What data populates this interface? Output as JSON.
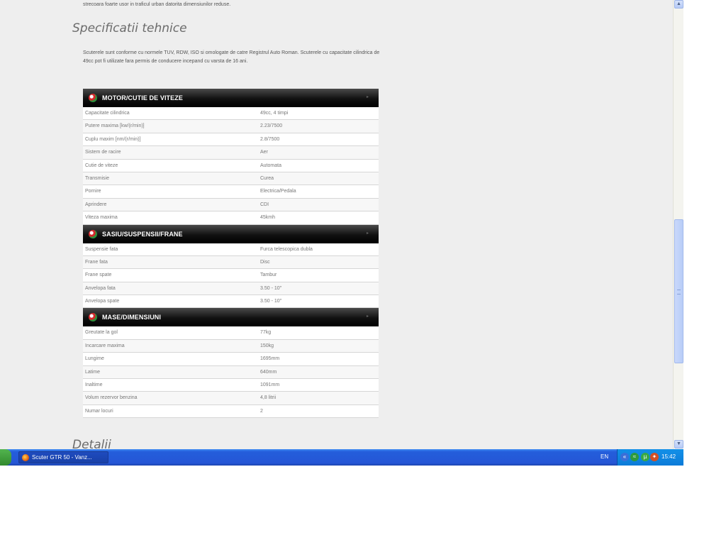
{
  "page": {
    "intro_tail": "strecoara foarte usor in traficul urban datorita dimensiunilor reduse.",
    "section_title": "Specificatii tehnice",
    "section_text": "Scuterele sunt conforme cu normele TUV, RDW, ISO si omologate de catre Registrul Auto Roman. Scuterele cu capacitate cilindrica de 49cc pot fi utilizate fara permis de conducere incepand cu varsta de 16 ani.",
    "next_title": "Detalii"
  },
  "spec_groups": [
    {
      "title": "MOTOR/CUTIE DE VITEZE",
      "rows": [
        {
          "k": "Capacitate cilindrica",
          "v": "49cc, 4 timpi"
        },
        {
          "k": "Putere maxima [kw/(r/min)]",
          "v": "2.23/7500"
        },
        {
          "k": "Cuplu maxim [nm/(r/min)]",
          "v": "2.8/7500"
        },
        {
          "k": "Sistem de racire",
          "v": "Aer"
        },
        {
          "k": "Cutie de viteze",
          "v": "Automata"
        },
        {
          "k": "Transmisie",
          "v": "Curea"
        },
        {
          "k": "Pornire",
          "v": "Electrica/Pedala"
        },
        {
          "k": "Aprindere",
          "v": "CDI"
        },
        {
          "k": "Viteza maxima",
          "v": "45kmh"
        }
      ]
    },
    {
      "title": "SASIU/SUSPENSII/FRANE",
      "rows": [
        {
          "k": "Suspensie fata",
          "v": "Furca telescopica dubla"
        },
        {
          "k": "Frane fata",
          "v": "Disc"
        },
        {
          "k": "Frane spate",
          "v": "Tambur"
        },
        {
          "k": "Anvelopa fata",
          "v": "3.50 - 10\""
        },
        {
          "k": "Anvelopa spate",
          "v": "3.50 - 10\""
        }
      ]
    },
    {
      "title": "MASE/DIMENSIUNI",
      "rows": [
        {
          "k": "Greutate la gol",
          "v": "77kg"
        },
        {
          "k": "Incarcare maxima",
          "v": "150kg"
        },
        {
          "k": "Lungime",
          "v": "1695mm"
        },
        {
          "k": "Latime",
          "v": "640mm"
        },
        {
          "k": "Inaltime",
          "v": "1091mm"
        },
        {
          "k": "Volum rezervor benzina",
          "v": "4,8 litrii"
        },
        {
          "k": "Numar locuri",
          "v": "2"
        }
      ]
    }
  ],
  "scrollbar": {
    "up_icon": "scroll-up-arrow-icon",
    "down_icon": "scroll-down-arrow-icon",
    "position_fraction": 0.6
  },
  "taskbar": {
    "window_button_label": "Scuter GTR 50 - Vanz...",
    "window_icon": "firefox-icon",
    "language": "EN",
    "clock": "15:42"
  },
  "colors": {
    "page_bg": "#eeeeee",
    "header_bg": "#000000",
    "taskbar_blue": "#245edb"
  }
}
